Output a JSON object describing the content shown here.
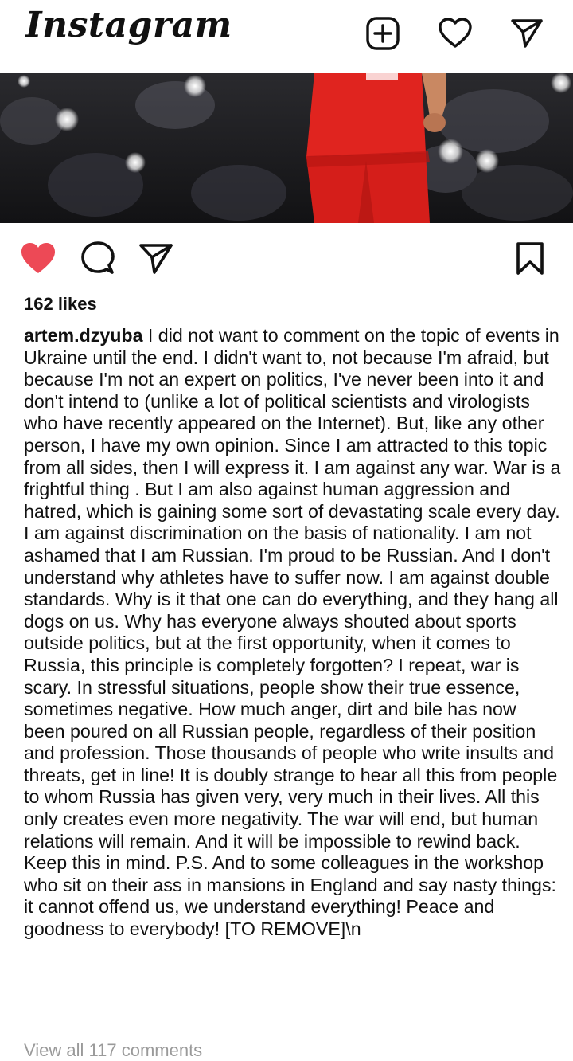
{
  "app": {
    "logo_text": "Instagram"
  },
  "header": {
    "icons": [
      "plus-square-icon",
      "heart-icon",
      "direct-send-icon"
    ]
  },
  "post": {
    "media_alt": "football-player-photo",
    "liked": true,
    "likes_label": "162 likes",
    "username": "artem.dzyuba",
    "caption": " I did not want to comment on the topic of events in Ukraine until the end. I didn't want to, not because I'm afraid, but because I'm not an expert on politics, I've never been into it and don't intend to (unlike a lot of political scientists and virologists who have recently appeared on the Internet). But, like any other person, I have my own opinion. Since I am attracted to this topic from all sides, then I will express it. I am against any war. War is a frightful thing . But I am also against human aggression and hatred, which is gaining some sort of devastating scale every day. I am against discrimination on the basis of nationality. I am not ashamed that I am Russian. I'm proud to be Russian. And I don't understand why athletes have to suffer now. I am against double standards. Why is it that one can do everything, and they hang all dogs on us. Why has everyone always shouted about sports outside politics, but at the first opportunity, when it comes to Russia, this principle is completely forgotten? I repeat, war is scary. In stressful situations, people show their true essence, sometimes negative. How much anger, dirt and bile has now been poured on all Russian people, regardless of their position and profession. Those thousands of people who write insults and threats, get in line! It is doubly strange to hear all this from people to whom Russia has given very, very much in their lives. All this only creates even more negativity. The war will end, but human relations will remain. And it will be impossible to rewind back. Keep this in mind. P.S. And to some colleagues in the workshop who sit on their ass in mansions in England and say nasty things: it cannot offend us, we understand everything! Peace and goodness to everybody! [TO REMOVE]\\n",
    "views_label": "View all 117 comments"
  },
  "colors": {
    "like_red": "#ED4956",
    "text": "#111111",
    "muted": "#9A9A9A",
    "jersey_red": "#E0241F"
  },
  "action_icons": [
    "heart-filled-icon",
    "comment-icon",
    "share-icon",
    "bookmark-icon"
  ]
}
